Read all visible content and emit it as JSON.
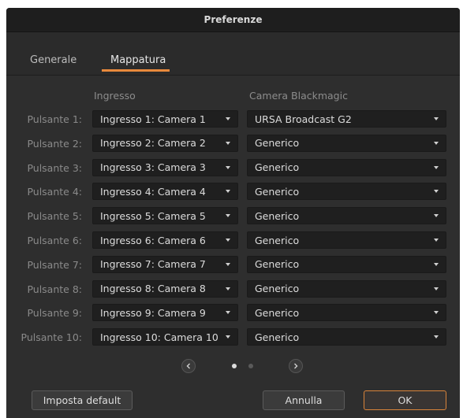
{
  "window": {
    "title": "Preferenze"
  },
  "tabs": [
    {
      "label": "Generale",
      "active": false
    },
    {
      "label": "Mappatura",
      "active": true
    }
  ],
  "columns": {
    "input_header": "Ingresso",
    "camera_header": "Camera Blackmagic"
  },
  "rows": [
    {
      "label": "Pulsante 1:",
      "input": "Ingresso 1: Camera 1",
      "camera": "URSA Broadcast G2"
    },
    {
      "label": "Pulsante 2:",
      "input": "Ingresso 2: Camera 2",
      "camera": "Generico"
    },
    {
      "label": "Pulsante 3:",
      "input": "Ingresso 3: Camera 3",
      "camera": "Generico"
    },
    {
      "label": "Pulsante 4:",
      "input": "Ingresso 4: Camera 4",
      "camera": "Generico"
    },
    {
      "label": "Pulsante 5:",
      "input": "Ingresso 5: Camera 5",
      "camera": "Generico"
    },
    {
      "label": "Pulsante 6:",
      "input": "Ingresso 6: Camera 6",
      "camera": "Generico"
    },
    {
      "label": "Pulsante 7:",
      "input": "Ingresso 7: Camera 7",
      "camera": "Generico"
    },
    {
      "label": "Pulsante 8:",
      "input": "Ingresso 8: Camera 8",
      "camera": "Generico"
    },
    {
      "label": "Pulsante 9:",
      "input": "Ingresso 9: Camera 9",
      "camera": "Generico"
    },
    {
      "label": "Pulsante 10:",
      "input": "Ingresso 10: Camera 10",
      "camera": "Generico"
    }
  ],
  "pagination": {
    "current_page": 1,
    "total_pages": 2
  },
  "footer": {
    "default_label": "Imposta default",
    "cancel_label": "Annulla",
    "ok_label": "OK"
  },
  "colors": {
    "accent": "#e8893c",
    "background": "#2e2e2e",
    "field": "#1f1f1f"
  }
}
